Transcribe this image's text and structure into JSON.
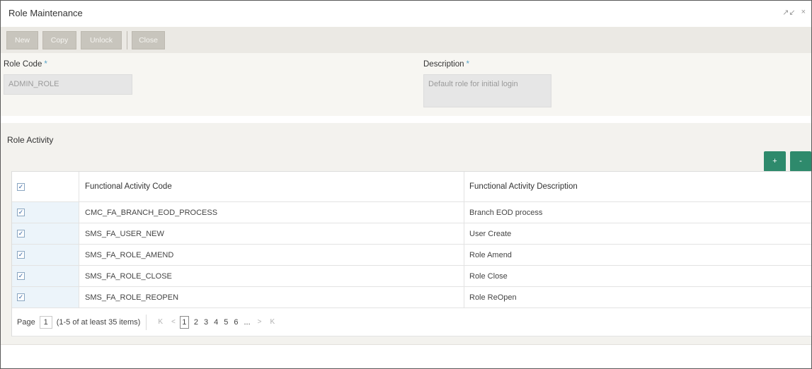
{
  "window": {
    "title": "Role Maintenance",
    "restore_icon": "↗↙",
    "close_icon": "×"
  },
  "toolbar": {
    "new_label": "New",
    "copy_label": "Copy",
    "unlock_label": "Unlock",
    "close_label": "Close"
  },
  "form": {
    "role_code_label": "Role Code",
    "role_code_value": "ADMIN_ROLE",
    "description_label": "Description",
    "description_value": "Default role for initial login",
    "required_mark": "*"
  },
  "role_activity": {
    "title": "Role Activity",
    "add_label": "+",
    "remove_label": "-",
    "columns": [
      "Functional Activity Code",
      "Functional Activity Description"
    ],
    "rows": [
      {
        "code": "CMC_FA_BRANCH_EOD_PROCESS",
        "description": "Branch EOD process",
        "checked": true
      },
      {
        "code": "SMS_FA_USER_NEW",
        "description": "User Create",
        "checked": true
      },
      {
        "code": "SMS_FA_ROLE_AMEND",
        "description": "Role Amend",
        "checked": true
      },
      {
        "code": "SMS_FA_ROLE_CLOSE",
        "description": "Role Close",
        "checked": true
      },
      {
        "code": "SMS_FA_ROLE_REOPEN",
        "description": "Role ReOpen",
        "checked": true
      }
    ]
  },
  "pager": {
    "page_label": "Page",
    "page_value": "1",
    "summary": "(1-5 of at least 35 items)",
    "first_icon": "K",
    "prev_icon": "<",
    "pages": [
      "1",
      "2",
      "3",
      "4",
      "5",
      "6",
      "..."
    ],
    "next_icon": ">",
    "last_icon": "K"
  },
  "colors": {
    "accent_green": "#2e8a6c",
    "required_blue": "#59a5c8",
    "toolbar_button": "#c8c5bd"
  }
}
